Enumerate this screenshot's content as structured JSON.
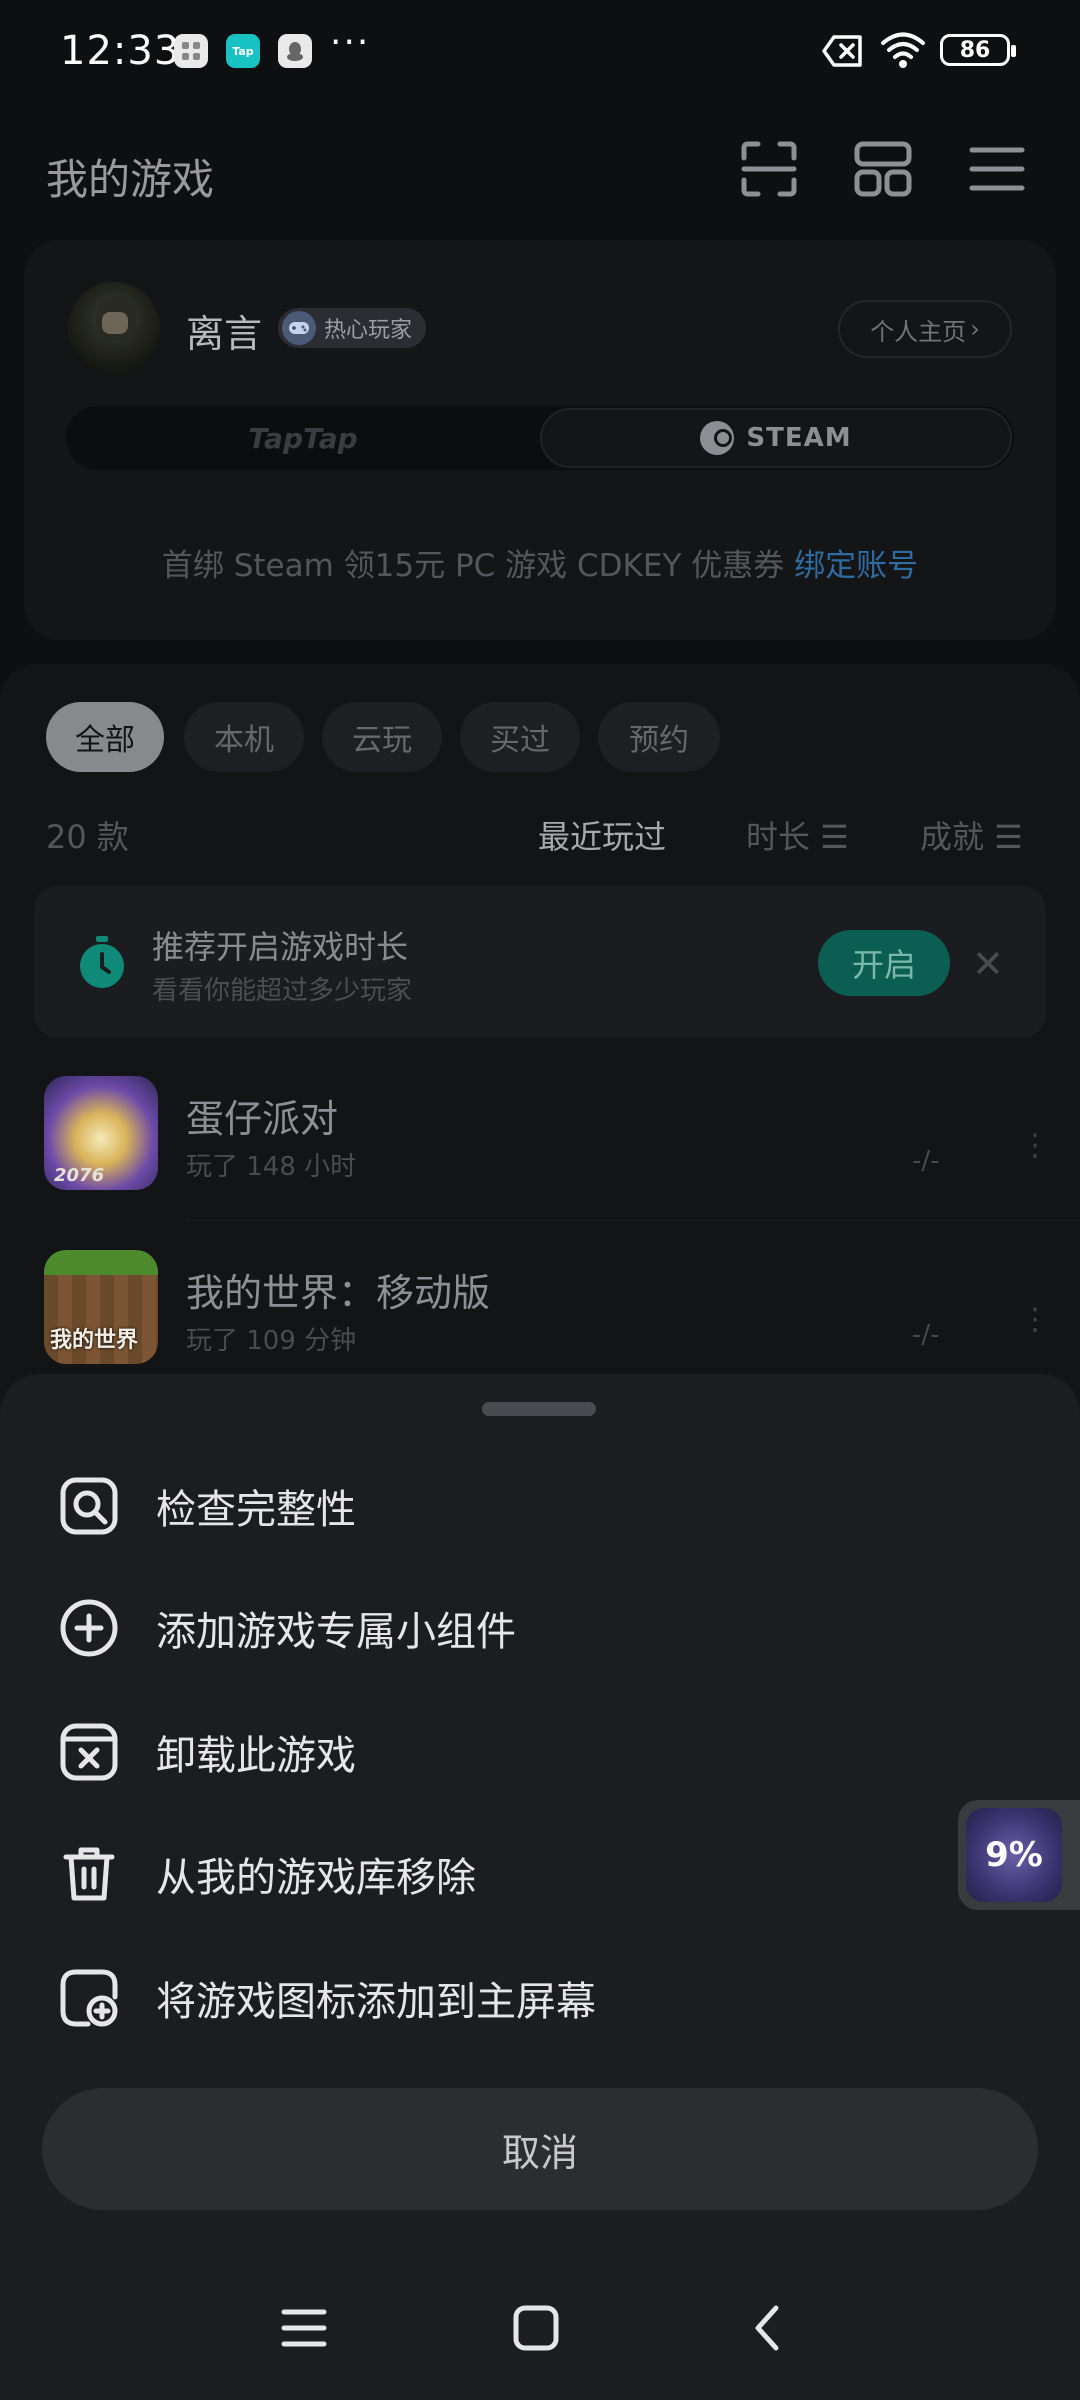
{
  "status_bar": {
    "time": "12:33",
    "battery": "86",
    "more": "···",
    "app_tap": "Tap"
  },
  "header": {
    "title": "我的游戏"
  },
  "profile": {
    "username": "离言",
    "badge": "热心玩家",
    "homepage": "个人主页",
    "homepage_chevron": "›",
    "platform_taptap": "TapTap",
    "platform_steam": "STEAM",
    "promo_text": "首绑 Steam 领15元 PC 游戏 CDKEY 优惠券",
    "promo_link": "绑定账号"
  },
  "filters": [
    "全部",
    "本机",
    "云玩",
    "买过",
    "预约"
  ],
  "library": {
    "count": "20 款",
    "sort_recent": "最近玩过",
    "sort_duration": "时长 ☰",
    "sort_achievement": "成就 ☰"
  },
  "recommend": {
    "title": "推荐开启游戏时长",
    "subtitle": "看看你能超过多少玩家",
    "enable": "开启",
    "close": "✕"
  },
  "games": [
    {
      "name": "蛋仔派对",
      "played": "玩了 148 小时",
      "score": "-/-"
    },
    {
      "name": "我的世界：移动版",
      "played": "玩了 109 分钟",
      "score": "-/-"
    }
  ],
  "sheet": {
    "items": [
      {
        "label": "检查完整性",
        "icon": "search-check-icon"
      },
      {
        "label": "添加游戏专属小组件",
        "icon": "add-circle-icon"
      },
      {
        "label": "卸载此游戏",
        "icon": "uninstall-icon"
      },
      {
        "label": "从我的游戏库移除",
        "icon": "trash-icon"
      },
      {
        "label": "将游戏图标添加到主屏幕",
        "icon": "add-to-homescreen-icon"
      }
    ],
    "cancel": "取消"
  },
  "floating": {
    "progress": "9%"
  },
  "colors": {
    "accent_link": "#2f6aa0",
    "enable_green": "#0b5e52",
    "sheet_bg": "#1c1d21"
  }
}
